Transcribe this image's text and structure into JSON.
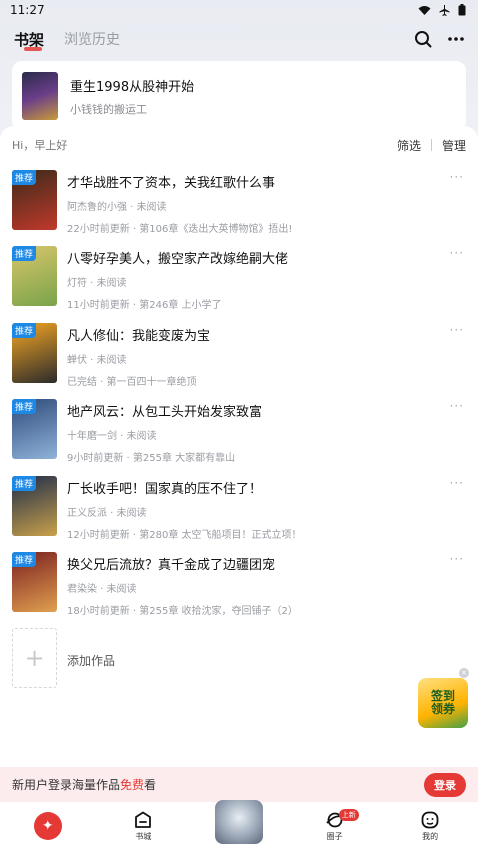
{
  "status": {
    "time": "11:27"
  },
  "header": {
    "tab_active": "书架",
    "tab_history": "浏览历史",
    "search_icon": "search-icon",
    "more_icon": "more-icon"
  },
  "recent": {
    "title": "重生1998从股神开始",
    "subtitle": "小钱钱的搬运工"
  },
  "shelf": {
    "greeting": "Hi，早上好",
    "filter_label": "筛选",
    "manage_label": "管理",
    "books": [
      {
        "tag": "推荐",
        "title": "才华战胜不了资本，关我红歌什么事",
        "author": "阿杰鲁的小强 · 未阅读",
        "update": "22小时前更新 · 第106章《迭出大英博物馆》捂出!",
        "cover": [
          "#3b2a1a",
          "#c0392b"
        ]
      },
      {
        "tag": "推荐",
        "title": "八零好孕美人，搬空家产改嫁绝嗣大佬",
        "author": "灯符 · 未阅读",
        "update": "11小时前更新 · 第246章 上小学了",
        "cover": [
          "#d8c66b",
          "#7aa34a"
        ]
      },
      {
        "tag": "推荐",
        "title": "凡人修仙：我能变废为宝",
        "author": "蝉伏 · 未阅读",
        "update": "已完结 · 第一百四十一章绝顶",
        "cover": [
          "#f5a623",
          "#2b2b2b"
        ]
      },
      {
        "tag": "推荐",
        "title": "地产风云：从包工头开始发家致富",
        "author": "十年磨一剑 · 未阅读",
        "update": "9小时前更新 · 第255章 大家都有靠山",
        "cover": [
          "#2e4a7a",
          "#8fb3d9"
        ]
      },
      {
        "tag": "推荐",
        "title": "厂长收手吧！国家真的压不住了！",
        "author": "正义反派 · 未阅读",
        "update": "12小时前更新 · 第280章 太空飞船项目！正式立项！",
        "cover": [
          "#1d2b4a",
          "#c9a14a"
        ]
      },
      {
        "tag": "推荐",
        "title": "换父兄后流放？真千金成了边疆团宠",
        "author": "君染染 · 未阅读",
        "update": "18小时前更新 · 第255章 收拾沈家，夺回铺子（2）",
        "cover": [
          "#7a1f1f",
          "#e0a050"
        ]
      }
    ],
    "add_label": "添加作品"
  },
  "promo": {
    "line1": "签到",
    "line2": "领券"
  },
  "login": {
    "text_prefix": "新用户登录海量作品",
    "text_highlight": "免费",
    "text_suffix": "看",
    "button": "登录"
  },
  "nav": {
    "items": [
      {
        "label": "",
        "icon": "home-logo-icon"
      },
      {
        "label": "书城",
        "icon": "bookstore-icon"
      },
      {
        "label": "",
        "icon": "featured-cover-icon"
      },
      {
        "label": "圈子",
        "icon": "circle-icon",
        "badge": "上新"
      },
      {
        "label": "我的",
        "icon": "profile-icon"
      }
    ]
  },
  "colors": {
    "accent": "#e53935",
    "tag": "#1e88e5"
  }
}
